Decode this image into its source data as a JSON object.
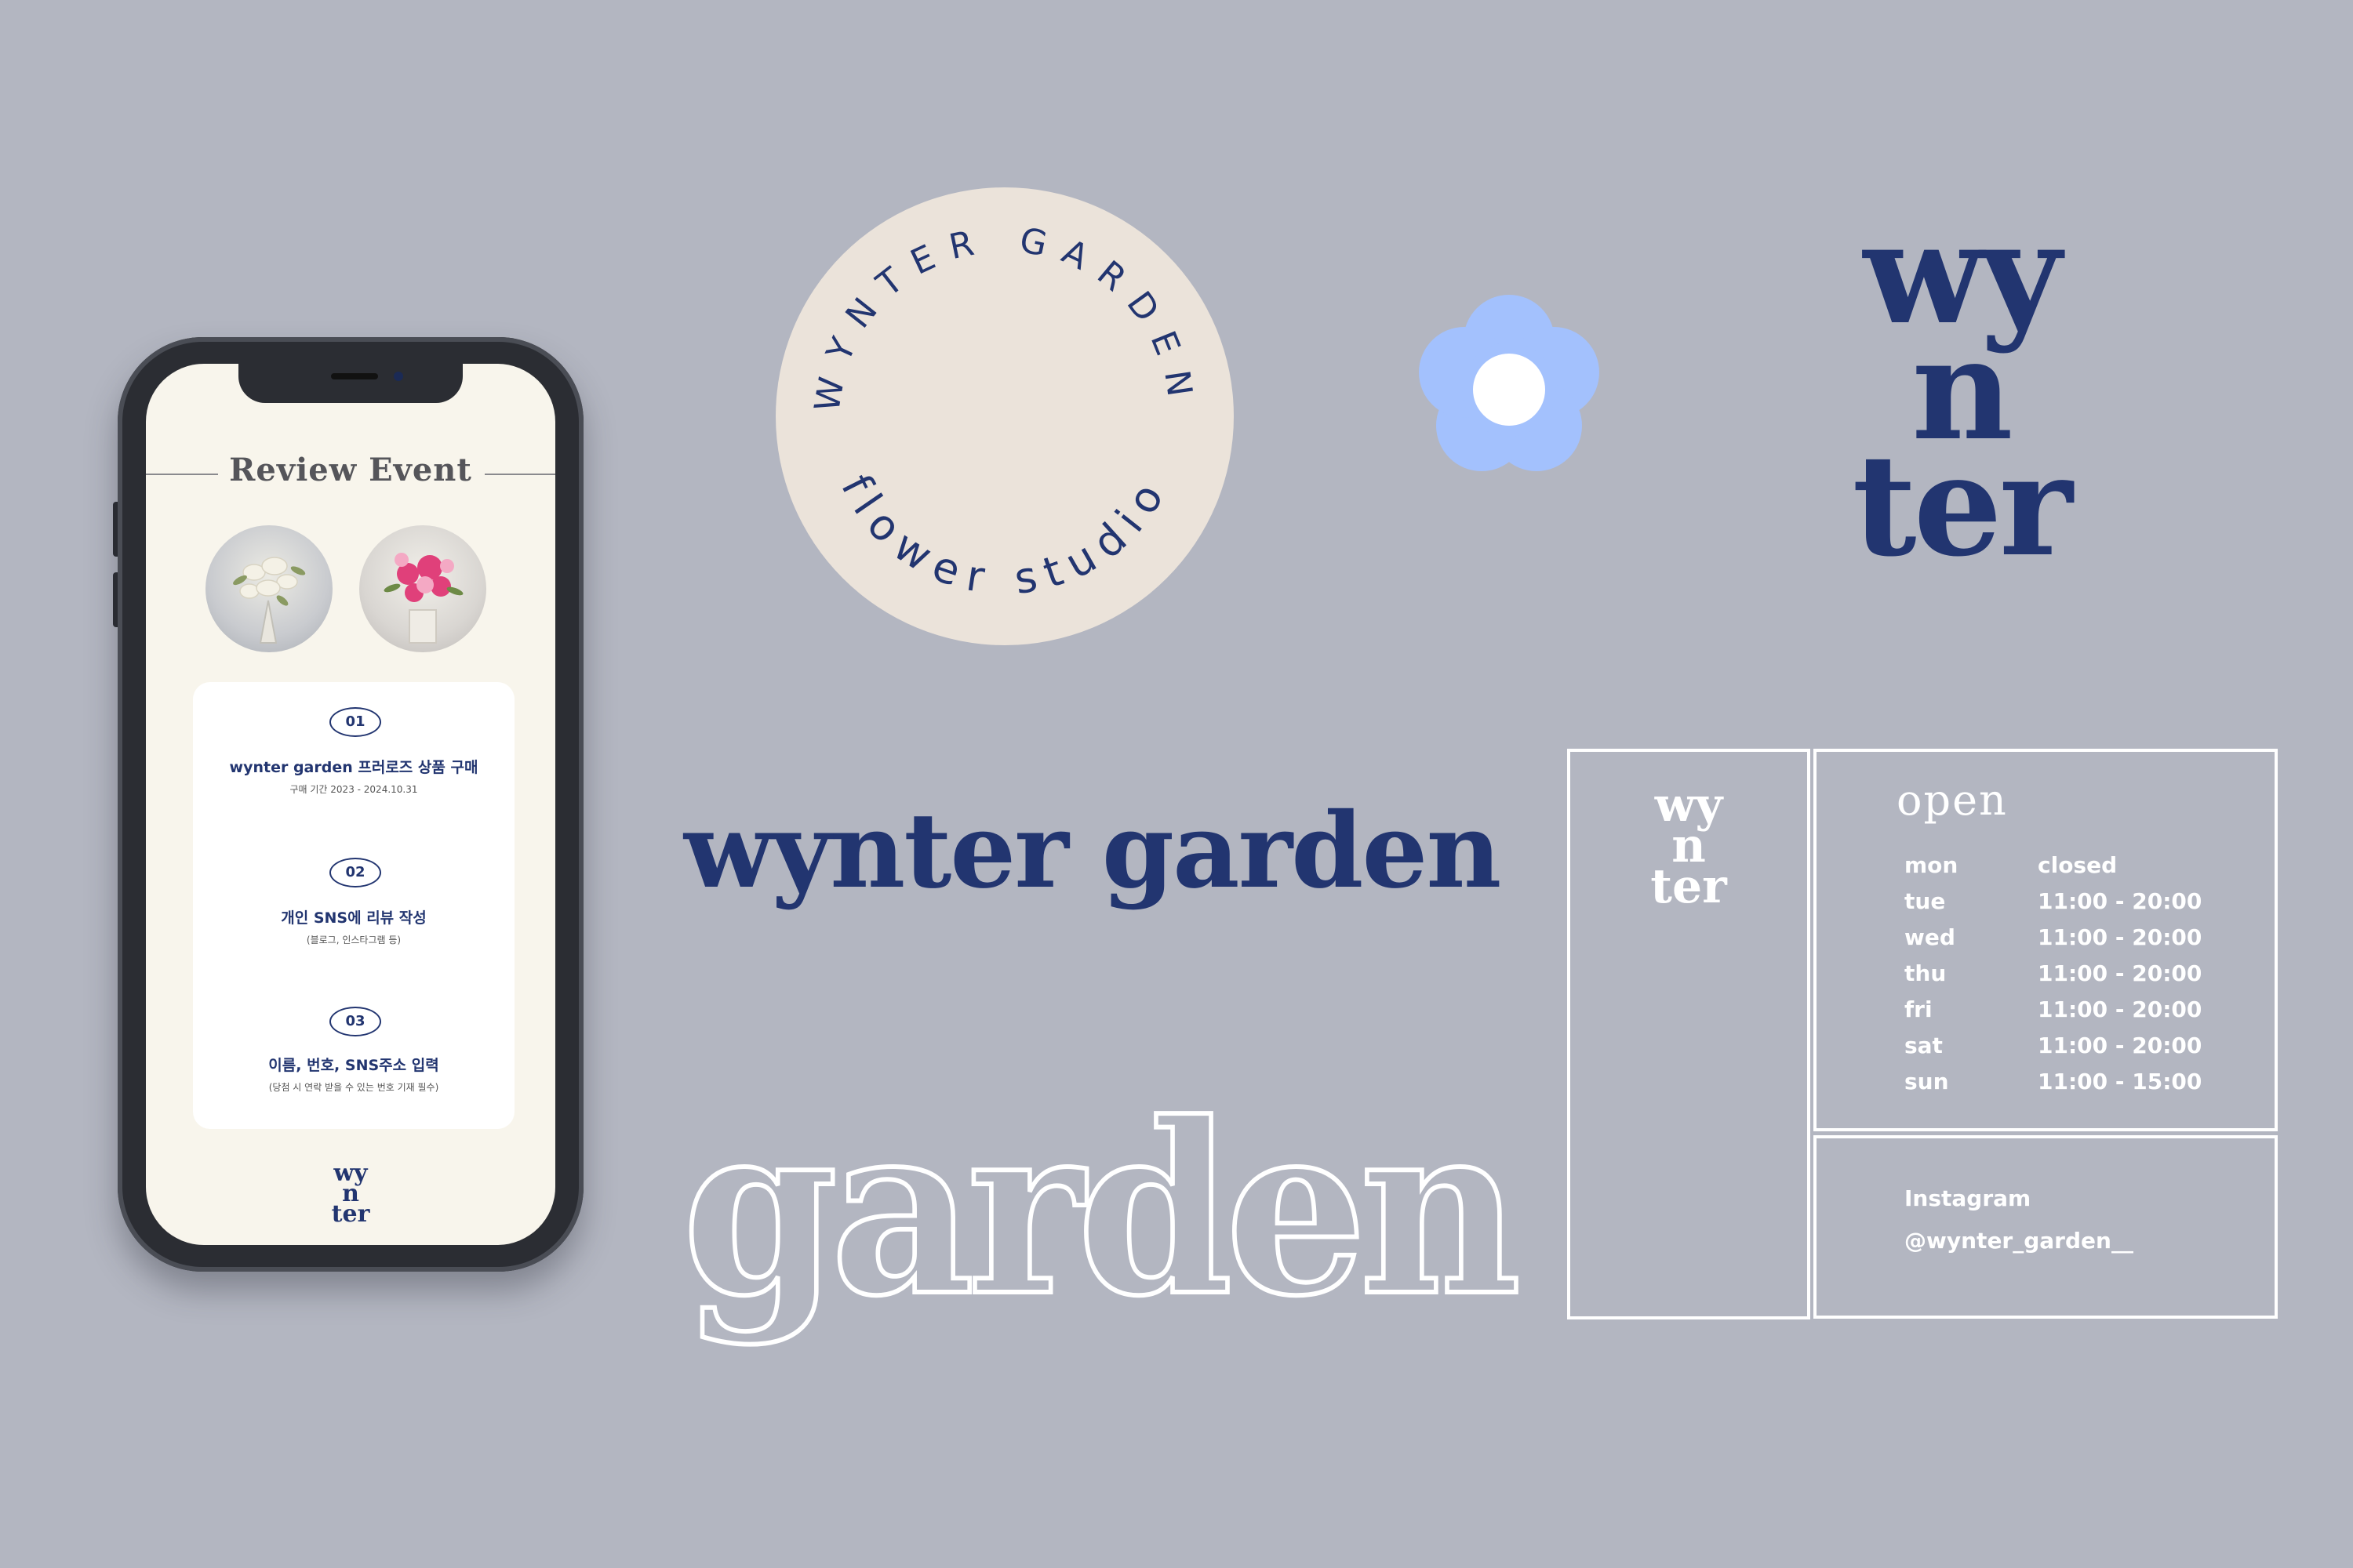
{
  "phone": {
    "review_title": "Review Event",
    "steps": [
      {
        "num": "01",
        "title": "wynter garden 프러로즈 상품 구매",
        "sub": "구매 기간 2023 - 2024.10.31"
      },
      {
        "num": "02",
        "title": "개인 SNS에 리뷰 작성",
        "sub": "(블로그, 인스타그램 등)"
      },
      {
        "num": "03",
        "title": "이름, 번호, SNS주소 입력",
        "sub": "(당첨 시 연락 받을 수 있는 번호 기재 필수)"
      }
    ],
    "mini_logo": [
      "wy",
      "n",
      "ter"
    ]
  },
  "badge": {
    "top_text": "WYNTER GARDEN",
    "bottom_text": "flower studio",
    "fill": "#ebe3da",
    "text_color": "#223570"
  },
  "flower": {
    "petal_color": "#a3c1fd",
    "center_color": "#ffffff"
  },
  "stack_logo": [
    "wy",
    "n",
    "ter"
  ],
  "wordmark": "wynter garden",
  "outline_word": "garden",
  "info": {
    "side_logo": [
      "wy",
      "n",
      "ter"
    ],
    "open_title": "open",
    "hours": [
      {
        "day": "mon",
        "time": "closed"
      },
      {
        "day": "tue",
        "time": "11:00 - 20:00"
      },
      {
        "day": "wed",
        "time": "11:00 - 20:00"
      },
      {
        "day": "thu",
        "time": "11:00 - 20:00"
      },
      {
        "day": "fri",
        "time": "11:00 - 20:00"
      },
      {
        "day": "sat",
        "time": "11:00 - 20:00"
      },
      {
        "day": "sun",
        "time": "11:00 - 15:00"
      }
    ],
    "instagram_label": "Instagram",
    "instagram_handle": "@wynter_garden__"
  },
  "colors": {
    "background": "#b3b6c1",
    "navy": "#223570",
    "cream": "#f8f5ec"
  }
}
